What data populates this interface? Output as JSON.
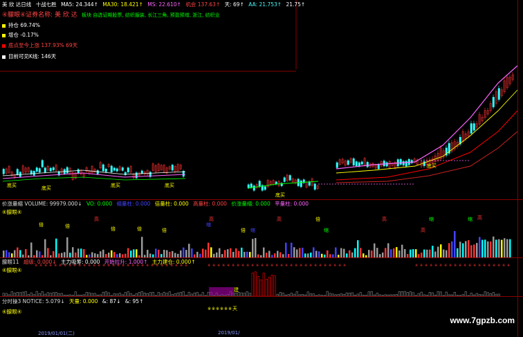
{
  "header": {
    "stock_name": "美 欣 达日线",
    "period": "十战七胜",
    "ma_items": [
      {
        "label": "MA5: 24.344↑",
        "color": "#ffffff"
      },
      {
        "label": "MA30: 18.421↑",
        "color": "#ffff00"
      },
      {
        "label": "MS: 22.610↑",
        "color": "#ff66ff"
      },
      {
        "label": "机会 137.63↑",
        "color": "#ff4444"
      },
      {
        "label": "天: 69↑",
        "color": "#ffffff"
      },
      {
        "label": "AA: 21.753↑",
        "color": "#44ffff"
      },
      {
        "label": "21.75↑",
        "color": "#ffffff"
      }
    ]
  },
  "info": {
    "name_line": "④朦眼④证券名称: 美 欣 达",
    "sector": "板块 自选证期股票, 纺织服装, 长江三角, 预盈预增, 浙江, 纺织业",
    "hold_ratio": "持仓 69.74%",
    "add_ratio": "增仓 -0.17%",
    "rise_line": "底点至今上涨 137.93%  69天",
    "visible_line": "目前可见K线: 146天"
  },
  "main_chart": {
    "marks": [
      {
        "text": "底买",
        "color": "#ffff00"
      },
      {
        "text": "底买",
        "color": "#ffff00"
      },
      {
        "text": "底买",
        "color": "#ffff00"
      },
      {
        "text": "底买",
        "color": "#ffff00"
      },
      {
        "text": "底买",
        "color": "#ffff00"
      },
      {
        "text": "底买",
        "color": "#ffff00"
      }
    ]
  },
  "volume_pane": {
    "title": "价涨量缩 VOLUME: 99979.000↓",
    "items": [
      {
        "label": "VO: 0.000",
        "color": "#00ff00"
      },
      {
        "label": "缩量柱: 0.000",
        "color": "#4444ff"
      },
      {
        "label": "倍量柱: 0.000",
        "color": "#ffff00"
      },
      {
        "label": "高量柱: 0.000",
        "color": "#ff4444"
      },
      {
        "label": "价涨量缩: 0.000",
        "color": "#00ff00"
      },
      {
        "label": "平量柱: 0.000",
        "color": "#ff66ff"
      }
    ],
    "sub_label": "④朦眼④",
    "tags": [
      "倍",
      "倍",
      "高",
      "倍",
      "倍",
      "倍",
      "缩",
      "高",
      "倍",
      "缩",
      "高",
      "倍",
      "缩",
      "高",
      "高",
      "缩",
      "缩",
      "高"
    ]
  },
  "fund_pane": {
    "title": "朦眼11",
    "items": [
      {
        "label": "超级: 0.000↓",
        "color": "#ff4444"
      },
      {
        "label": "主力吸筹: 0.000",
        "color": "#ffffff"
      },
      {
        "label": "开始拉升: 1.000↑",
        "color": "#ff66ff"
      },
      {
        "label": "主力建仓: 0.000↑",
        "color": "#ffff00"
      }
    ],
    "sub_label": "④朦眼④",
    "tag": "建"
  },
  "tick_pane": {
    "title": "分时操3 NOTICE: 5.079↓",
    "items": [
      {
        "label": "天量: 0.000",
        "color": "#ffff00"
      },
      {
        "label": "&: 87↓",
        "color": "#ffffff"
      },
      {
        "label": "&: 95↑",
        "color": "#ffffff"
      }
    ],
    "sub_label": "④朦眼④",
    "tag": "天"
  },
  "footer": {
    "dates": [
      "2019/01/01(二)",
      "2019/01/"
    ]
  },
  "watermark": "www.7gpzb.com"
}
